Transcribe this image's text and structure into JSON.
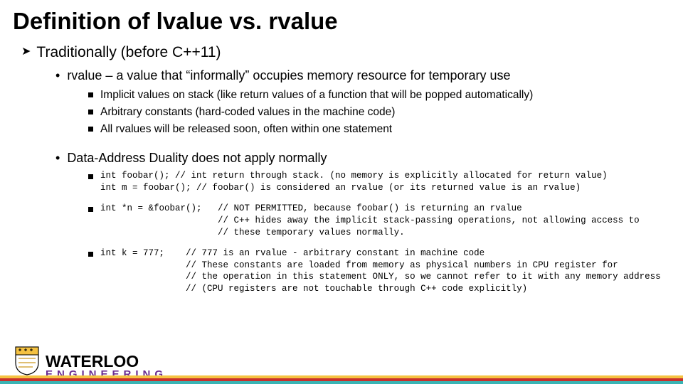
{
  "title": "Definition of lvalue vs. rvalue",
  "bullets": {
    "lvl1_1": "Traditionally (before C++11)",
    "lvl2_1": "rvalue – a value that “informally” occupies memory resource for temporary use",
    "lvl3_1": "Implicit values on stack (like return values of a function that will be popped automatically)",
    "lvl3_2": "Arbitrary constants (hard-coded values in the machine code)",
    "lvl3_3": "All rvalues will be released soon, often within one statement",
    "lvl2_2": "Data-Address Duality does not apply normally",
    "code_1": "int foobar(); // int return through stack. (no memory is explicitly allocated for return value)\nint m = foobar(); // foobar() is considered an rvalue (or its returned value is an rvalue)",
    "code_2": "int *n = &foobar();   // NOT PERMITTED, because foobar() is returning an rvalue\n                      // C++ hides away the implicit stack-passing operations, not allowing access to\n                      // these temporary values normally.",
    "code_3": "int k = 777;    // 777 is an rvalue - arbitrary constant in machine code\n                // These constants are loaded from memory as physical numbers in CPU register for\n                // the operation in this statement ONLY, so we cannot refer to it with any memory address\n                // (CPU registers are not touchable through C++ code explicitly)"
  },
  "logo": {
    "top": "WATERLOO",
    "bottom": "ENGINEERING"
  }
}
